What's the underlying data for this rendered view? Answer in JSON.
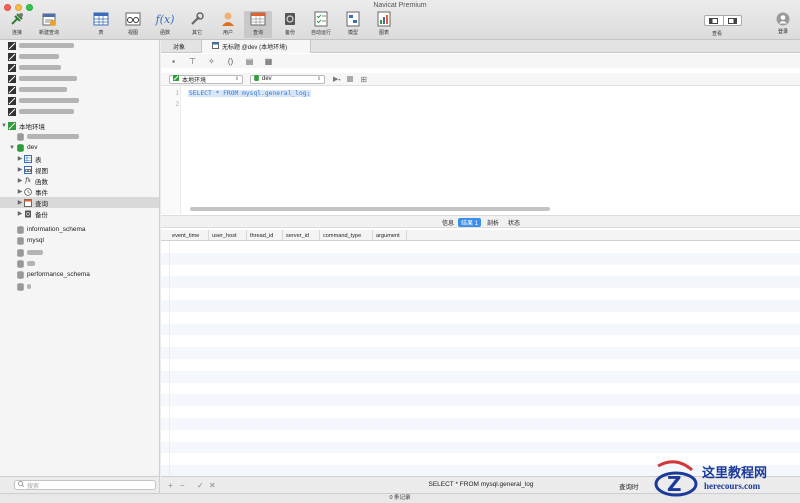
{
  "app_title": "Navicat Premium",
  "toolbar": {
    "items": [
      {
        "label": "连接"
      },
      {
        "label": "新建查询"
      },
      {
        "label": "表"
      },
      {
        "label": "视图"
      },
      {
        "label": "函数"
      },
      {
        "label": "其它"
      },
      {
        "label": "用户"
      },
      {
        "label": "查询"
      },
      {
        "label": "备份"
      },
      {
        "label": "自动运行"
      },
      {
        "label": "模型"
      },
      {
        "label": "图表"
      }
    ],
    "view_label": "查看",
    "login_label": "登录"
  },
  "sidebar": {
    "local_connection": "本地环境",
    "database": "dev",
    "db_children": [
      "表",
      "视图",
      "函数",
      "事件",
      "查询",
      "备份"
    ],
    "other_databases": [
      "information_schema",
      "mysql",
      "performance_schema"
    ],
    "search_placeholder": "搜索"
  },
  "tabs": {
    "objects": "对象",
    "query_tab": "无标题 @dev (本地环境)"
  },
  "connection_bar": {
    "connection": "本地环境",
    "database": "dev"
  },
  "editor": {
    "lines": [
      "1",
      "2"
    ],
    "sql": "SELECT * FROM mysql.general_log;"
  },
  "result_tabs": [
    "信息",
    "结果 1",
    "剖析",
    "状态"
  ],
  "result_columns": [
    "event_time",
    "user_host",
    "thread_id",
    "server_id",
    "command_type",
    "argument"
  ],
  "footer": {
    "sql_text": "SELECT * FROM mysql.general_log",
    "query_time_label": "查询时",
    "record_count": "0 条记录"
  },
  "watermark": {
    "title": "这里教程网",
    "site": "herecours.com"
  },
  "colors": {
    "accent": "#3b8eea",
    "sql_text": "#3a7bd5",
    "watermark": "#1b3a9a"
  }
}
